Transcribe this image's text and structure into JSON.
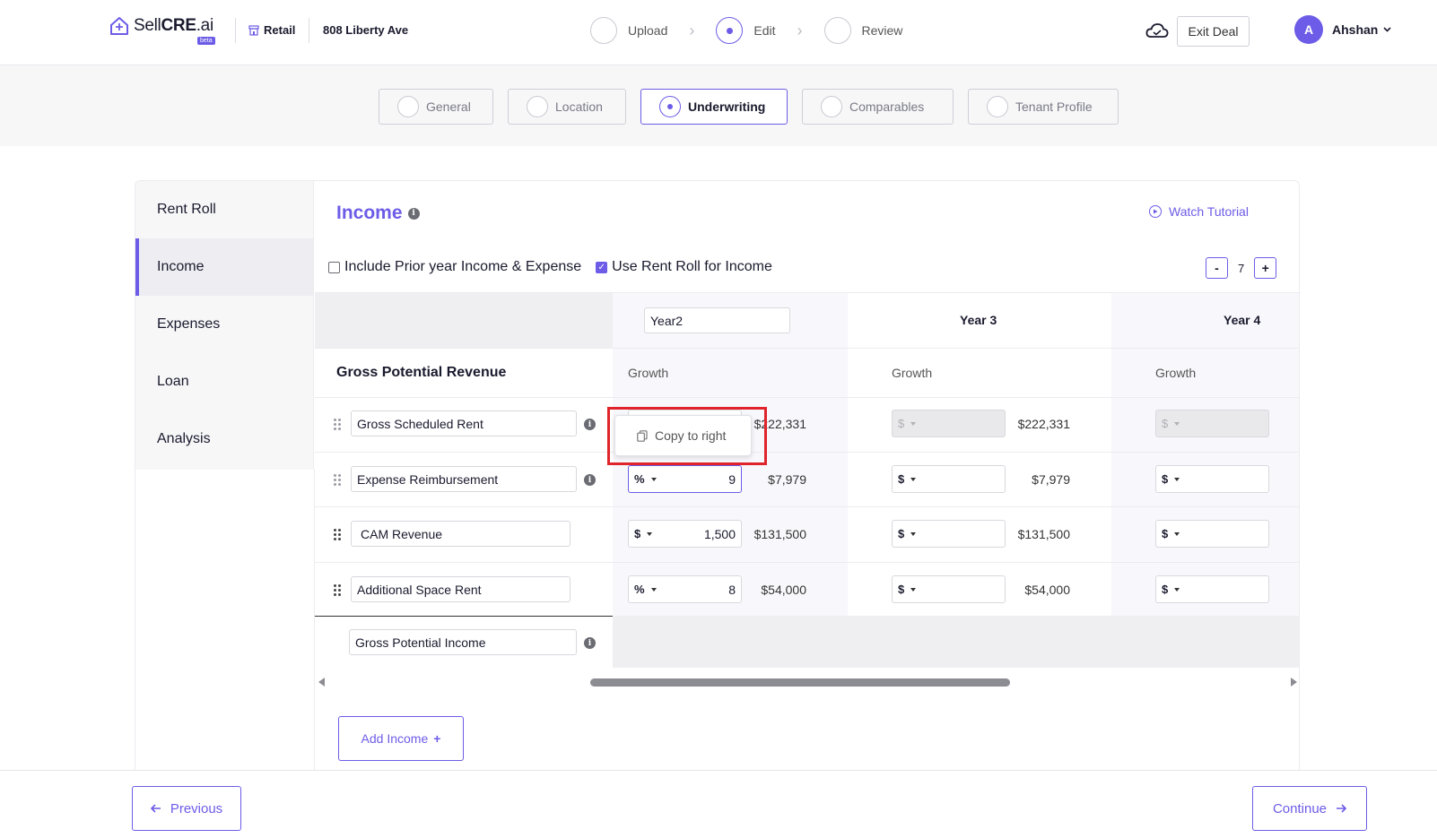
{
  "header": {
    "logo_prefix": "Sell",
    "logo_bold": "CRE",
    "logo_suffix": ".ai",
    "logo_badge": "beta",
    "property_type": "Retail",
    "address": "808 Liberty Ave",
    "steps": [
      "Upload",
      "Edit",
      "Review"
    ],
    "active_step": "Edit",
    "exit_label": "Exit Deal",
    "avatar_initial": "A",
    "user_name": "Ahshan"
  },
  "subtabs": {
    "items": [
      "General",
      "Location",
      "Underwriting",
      "Comparables",
      "Tenant Profile"
    ],
    "active": "Underwriting"
  },
  "sidebar": {
    "items": [
      "Rent Roll",
      "Income",
      "Expenses",
      "Loan",
      "Analysis"
    ],
    "active": "Income"
  },
  "income": {
    "title": "Income",
    "watch_tutorial": "Watch Tutorial",
    "opt_prior_year": "Include Prior year Income & Expense",
    "opt_prior_year_checked": false,
    "opt_rent_roll": "Use Rent Roll for Income",
    "opt_rent_roll_checked": true,
    "stepper_minus": "-",
    "stepper_value": "7",
    "stepper_plus": "+",
    "year2_value": "Year2",
    "year3_label": "Year 3",
    "year4_label": "Year 4",
    "section_title": "Gross Potential Revenue",
    "growth_label": "Growth",
    "rows": [
      {
        "name": "Gross Scheduled Rent",
        "y2_unit": "$",
        "y2_value": "",
        "y2_amount": "$222,331",
        "y3_unit": "$",
        "y3_amount": "$222,331",
        "y4_unit": "$"
      },
      {
        "name": "Expense Reimbursement",
        "y2_unit": "%",
        "y2_value": "9",
        "y2_amount": "$7,979",
        "y3_unit": "$",
        "y3_amount": "$7,979",
        "y4_unit": "$"
      },
      {
        "name": "CAM Revenue",
        "y2_unit": "$",
        "y2_value": "1,500",
        "y2_amount": "$131,500",
        "y3_unit": "$",
        "y3_amount": "$131,500",
        "y4_unit": "$"
      },
      {
        "name": "Additional Space Rent",
        "y2_unit": "%",
        "y2_value": "8",
        "y2_amount": "$54,000",
        "y3_unit": "$",
        "y3_amount": "$54,000",
        "y4_unit": "$"
      }
    ],
    "total_label": "Gross Potential Income",
    "copy_to_right": "Copy to right",
    "add_income": "Add Income",
    "add_icon": "+"
  },
  "footer": {
    "previous": "Previous",
    "continue": "Continue"
  },
  "colors": {
    "accent": "#6c5ce7",
    "highlight_box": "#e0242b"
  }
}
